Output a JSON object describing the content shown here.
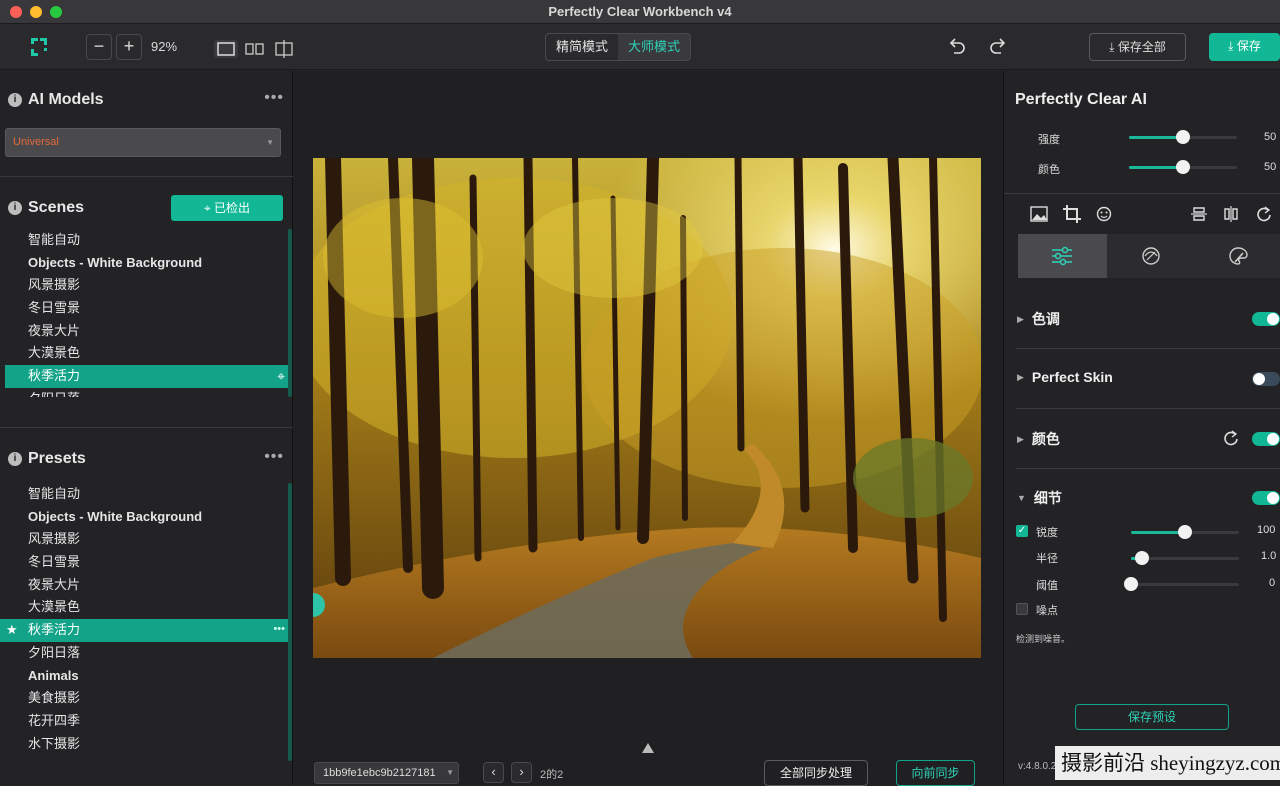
{
  "window": {
    "title": "Perfectly Clear Workbench v4"
  },
  "toolbar": {
    "zoom": "92%",
    "mode_simple": "精简模式",
    "mode_master": "大师模式",
    "save_all": "保存全部",
    "save": "保存"
  },
  "left": {
    "ai_models": {
      "title": "AI Models",
      "selected": "Universal"
    },
    "scenes": {
      "title": "Scenes",
      "detect_button": "已检出",
      "items": [
        "智能自动",
        "Objects - White Background",
        "风景摄影",
        "冬日雪景",
        "夜景大片",
        "大漠景色",
        "秋季活力",
        "夕阳日落"
      ]
    },
    "presets": {
      "title": "Presets",
      "items": [
        "智能自动",
        "Objects - White Background",
        "风景摄影",
        "冬日雪景",
        "夜景大片",
        "大漠景色",
        "秋季活力",
        "夕阳日落",
        "Animals",
        "美食摄影",
        "花开四季",
        "水下摄影"
      ]
    }
  },
  "center": {
    "filename": "1bb9fe1ebc9b2127181",
    "page": "2的2",
    "sync_all": "全部同步处理",
    "sync_forward": "向前同步"
  },
  "right": {
    "panel_title": "Perfectly Clear AI",
    "strength_label": "强度",
    "strength_value": "50",
    "strength_pct": 0.5,
    "color_label": "颜色",
    "color_value": "50",
    "color_pct": 0.5,
    "sections": {
      "tone": "色调",
      "skin": "Perfect Skin",
      "color": "颜色",
      "detail": "细节"
    },
    "detail": {
      "sharpness_label": "锐度",
      "sharpness_value": "100",
      "sharpness_pct": 0.5,
      "radius_label": "半径",
      "radius_value": "1.0",
      "radius_pct": 0.1,
      "threshold_label": "阈值",
      "threshold_value": "0",
      "threshold_pct": 0.0,
      "noise_label": "噪点",
      "noise_note": "检测到噪音。"
    },
    "save_preset": "保存预设",
    "version": "v:4.8.0.2"
  },
  "watermark": "摄影前沿 sheyingzyz.com",
  "colors": {
    "accent": "#12a388",
    "accent_text": "#2ed3b7",
    "orange": "#e36a3c"
  }
}
